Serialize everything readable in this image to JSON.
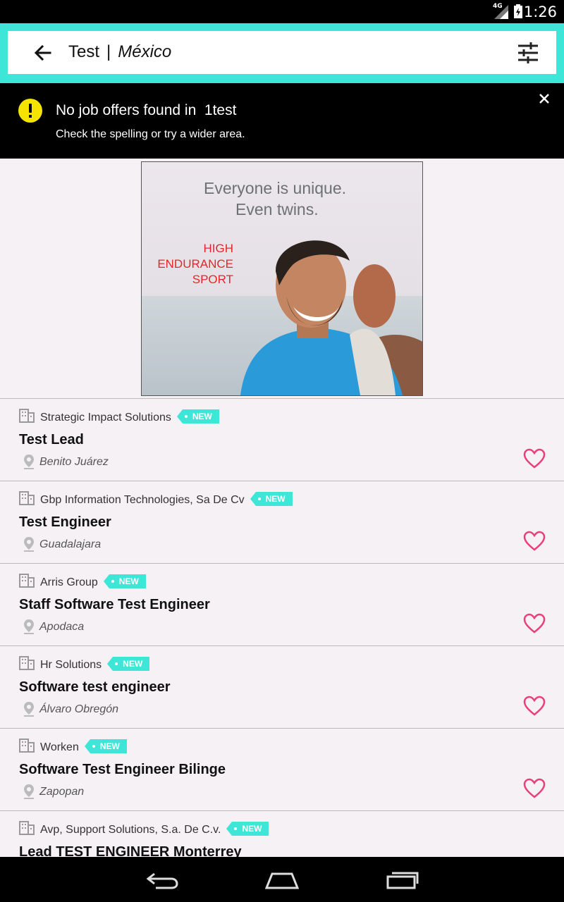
{
  "status": {
    "time": "1:26",
    "network": "4G"
  },
  "search": {
    "query": "Test",
    "separator": "|",
    "location": "México"
  },
  "notice": {
    "message": "No job offers found in  1test",
    "hint": "Check the spelling or try a wider area."
  },
  "ad": {
    "line1": "Everyone is unique.",
    "line2": "Even twins.",
    "tag1": "HIGH",
    "tag2": "ENDURANCE",
    "tag3": "SPORT"
  },
  "jobs": [
    {
      "company": "Strategic Impact Solutions",
      "badge": "NEW",
      "title": "Test Lead",
      "city": "Benito Juárez"
    },
    {
      "company": "Gbp Information Technologies, Sa De Cv",
      "badge": "NEW",
      "title": "Test Engineer",
      "city": "Guadalajara"
    },
    {
      "company": "Arris Group",
      "badge": "NEW",
      "title": "Staff Software Test Engineer",
      "city": "Apodaca"
    },
    {
      "company": "Hr Solutions",
      "badge": "NEW",
      "title": "Software test engineer",
      "city": "Álvaro Obregón"
    },
    {
      "company": "Worken",
      "badge": "NEW",
      "title": "Software Test Engineer Bilinge",
      "city": "Zapopan"
    },
    {
      "company": "Avp, Support Solutions, S.a. De C.v.",
      "badge": "NEW",
      "title": "Lead TEST ENGINEER Monterrey",
      "city": ""
    }
  ],
  "colors": {
    "accent": "#3ee6d8",
    "heart": "#e8407a",
    "warning": "#f5e400"
  }
}
